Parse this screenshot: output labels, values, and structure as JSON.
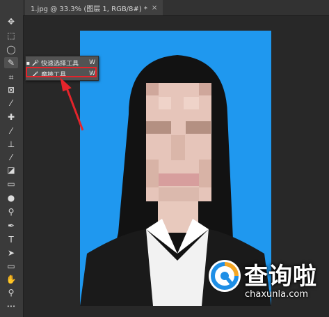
{
  "document": {
    "tab_title": "1.jpg @ 33.3% (图层 1, RGB/8#) *",
    "close_glyph": "×"
  },
  "toolbar": {
    "tools": [
      {
        "name": "move-tool",
        "icon": "move-icon",
        "glyph": "✥"
      },
      {
        "name": "marquee-tool",
        "icon": "marquee-icon",
        "glyph": "⬚"
      },
      {
        "name": "lasso-tool",
        "icon": "lasso-icon",
        "glyph": "◯"
      },
      {
        "name": "quick-selection-tool",
        "icon": "quick-selection-icon",
        "glyph": "✎"
      },
      {
        "name": "crop-tool",
        "icon": "crop-icon",
        "glyph": "⌗"
      },
      {
        "name": "frame-tool",
        "icon": "frame-icon",
        "glyph": "⊠"
      },
      {
        "name": "eyedropper-tool",
        "icon": "eyedropper-icon",
        "glyph": "⁄"
      },
      {
        "name": "healing-brush-tool",
        "icon": "bandage-icon",
        "glyph": "✚"
      },
      {
        "name": "brush-tool",
        "icon": "brush-icon",
        "glyph": "⁄"
      },
      {
        "name": "clone-stamp-tool",
        "icon": "stamp-icon",
        "glyph": "⊥"
      },
      {
        "name": "history-brush-tool",
        "icon": "history-brush-icon",
        "glyph": "⁄"
      },
      {
        "name": "eraser-tool",
        "icon": "eraser-icon",
        "glyph": "◪"
      },
      {
        "name": "gradient-tool",
        "icon": "gradient-icon",
        "glyph": "▭"
      },
      {
        "name": "blur-tool",
        "icon": "blur-drop-icon",
        "glyph": "●"
      },
      {
        "name": "dodge-tool",
        "icon": "dodge-icon",
        "glyph": "⚲"
      },
      {
        "name": "pen-tool",
        "icon": "pen-icon",
        "glyph": "✒"
      },
      {
        "name": "type-tool",
        "icon": "type-icon",
        "glyph": "T"
      },
      {
        "name": "path-selection-tool",
        "icon": "arrow-cursor-icon",
        "glyph": "➤"
      },
      {
        "name": "shape-tool",
        "icon": "rectangle-icon",
        "glyph": "▭"
      },
      {
        "name": "hand-tool",
        "icon": "hand-icon",
        "glyph": "✋"
      },
      {
        "name": "zoom-tool",
        "icon": "zoom-icon",
        "glyph": "⚲"
      },
      {
        "name": "more-tools",
        "icon": "ellipsis-icon",
        "glyph": "•••"
      }
    ]
  },
  "flyout": {
    "items": [
      {
        "label": "快速选择工具",
        "shortcut": "W",
        "bullet": "▪",
        "icon": "quick-selection-icon"
      },
      {
        "label": "魔棒工具",
        "shortcut": "W",
        "bullet": "",
        "icon": "magic-wand-icon"
      }
    ]
  },
  "watermark": {
    "brand_text": "查询啦",
    "url_text": "chaxunla.com"
  },
  "colors": {
    "photo_background": "#1f98ef",
    "highlight": "#e5242b",
    "arrow": "#e5242b"
  }
}
